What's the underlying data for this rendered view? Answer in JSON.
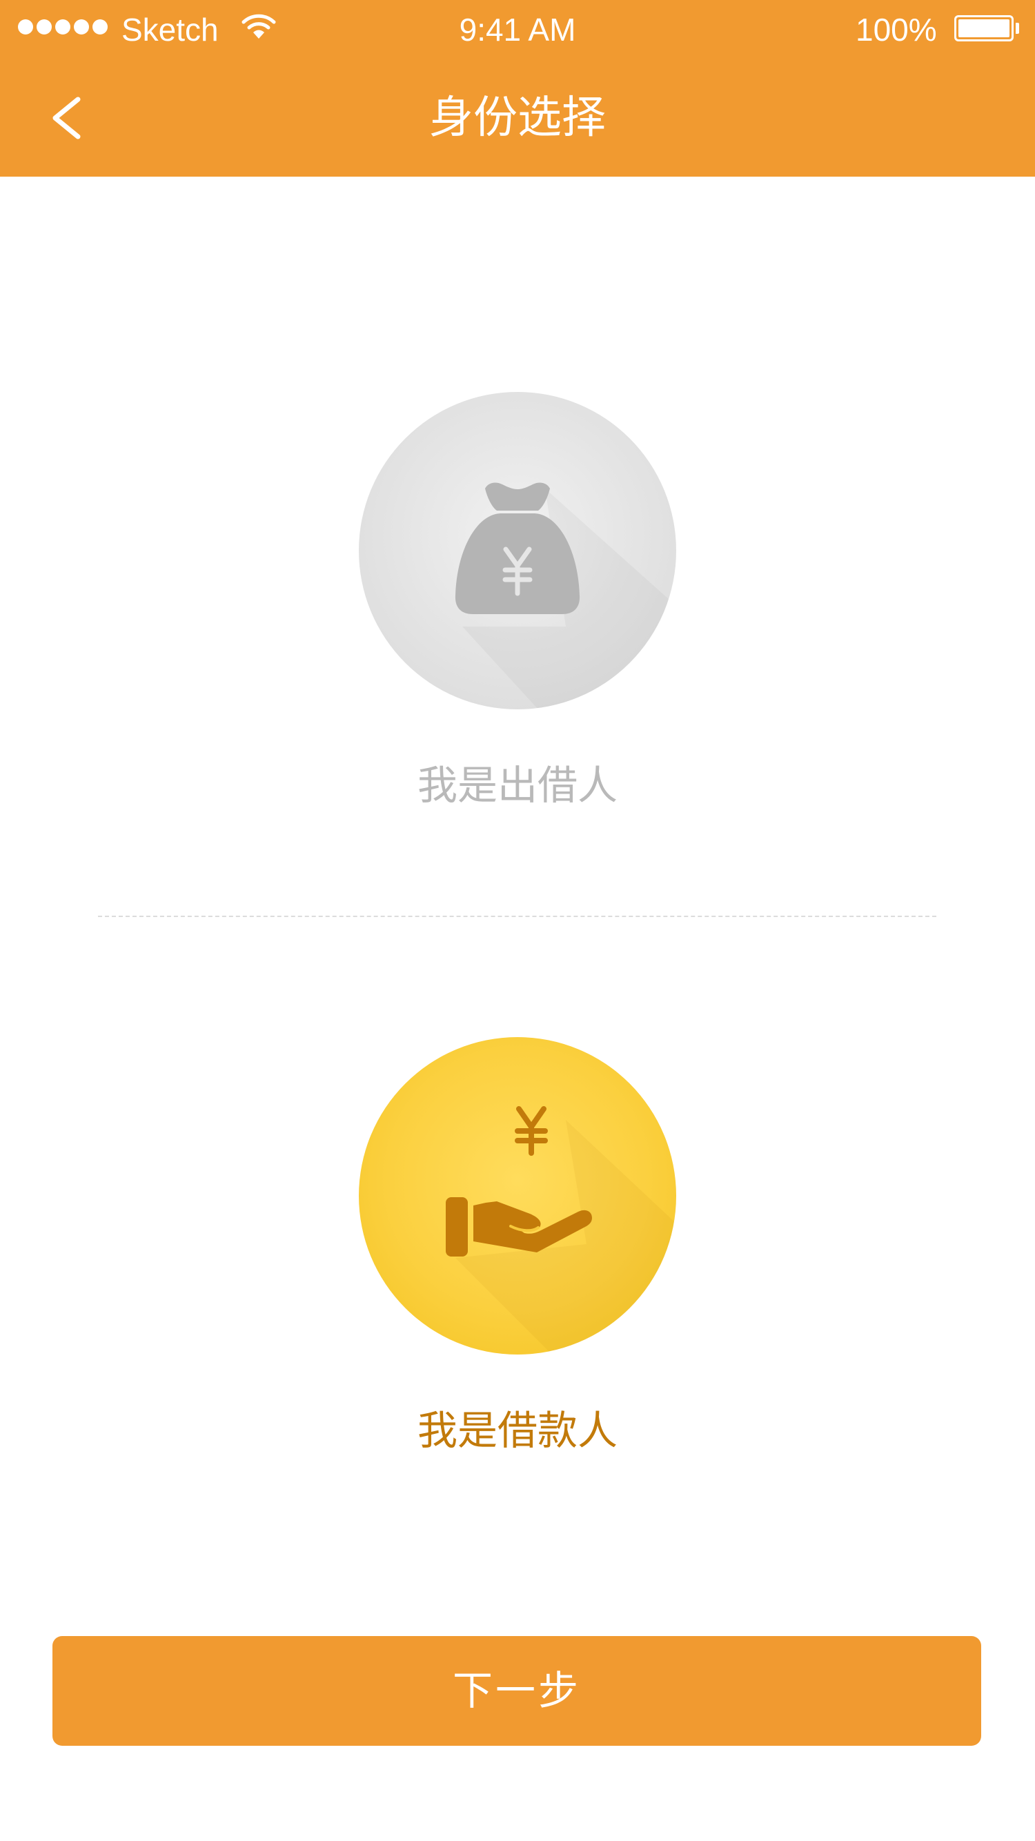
{
  "status_bar": {
    "carrier": "Sketch",
    "time": "9:41 AM",
    "battery": "100%",
    "signal_icon": "signal-dots-icon",
    "wifi_icon": "wifi-icon",
    "battery_icon": "battery-icon"
  },
  "nav": {
    "title": "身份选择",
    "back_icon": "chevron-left-icon"
  },
  "roles": [
    {
      "label": "我是出借人",
      "icon": "money-bag-yen-icon",
      "selected": false,
      "accent": "#b9b9b9"
    },
    {
      "label": "我是借款人",
      "icon": "hand-receiving-yen-icon",
      "selected": true,
      "accent": "#C27A0A"
    }
  ],
  "footer": {
    "next_label": "下一步"
  },
  "colors": {
    "primary": "#F19A30",
    "gold": "#F9C934",
    "gold_icon": "#C27A0A",
    "gray_icon": "#b4b4b4"
  }
}
